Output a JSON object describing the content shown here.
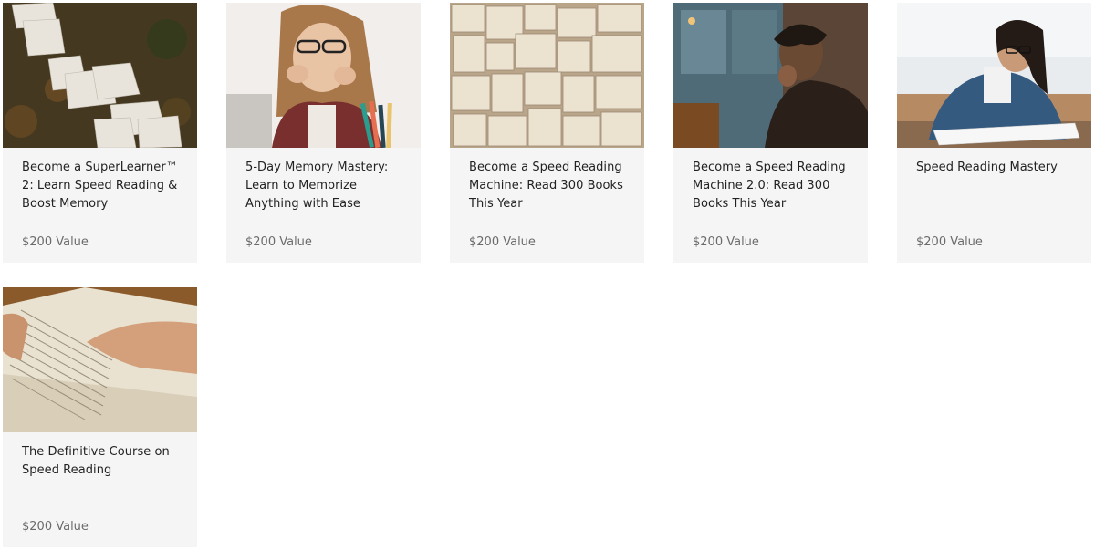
{
  "courses": [
    {
      "title": "Become a SuperLearner™ 2: Learn Speed Reading & Boost Memory",
      "value": "$200 Value",
      "image": "pages-on-grass-photo"
    },
    {
      "title": "5-Day Memory Mastery: Learn to Memorize Anything with Ease",
      "value": "$200 Value",
      "image": "woman-biting-pencil-photo"
    },
    {
      "title": "Become a Speed Reading Machine: Read 300 Books This Year",
      "value": "$200 Value",
      "image": "open-books-collage-photo"
    },
    {
      "title": "Become a Speed Reading Machine 2.0: Read 300 Books This Year",
      "value": "$200 Value",
      "image": "man-reading-cafe-photo"
    },
    {
      "title": "Speed Reading Mastery",
      "value": "$200 Value",
      "image": "woman-studying-photo"
    },
    {
      "title": "The Definitive Course on Speed Reading",
      "value": "$200 Value",
      "image": "hand-on-book-photo"
    }
  ]
}
